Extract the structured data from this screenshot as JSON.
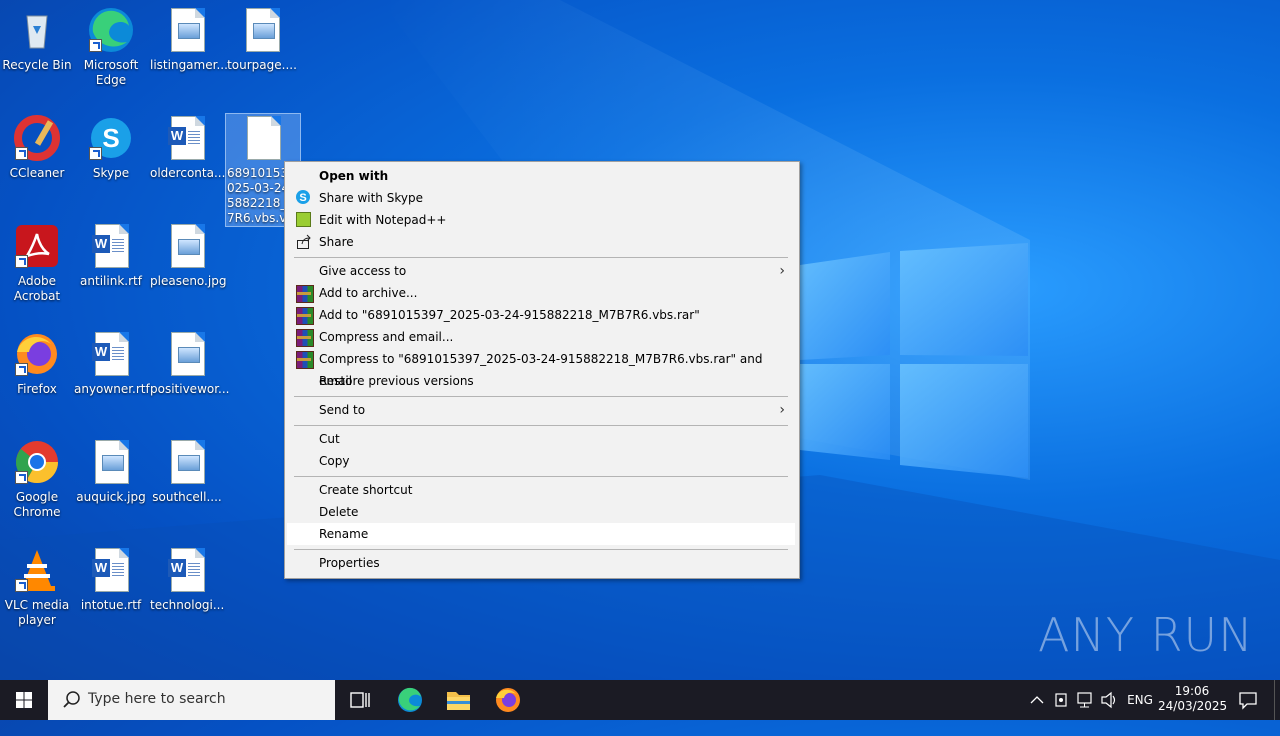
{
  "desktop": {
    "icons": [
      {
        "label": "Recycle Bin"
      },
      {
        "label": "Microsoft Edge"
      },
      {
        "label": "listingamer..."
      },
      {
        "label": "tourpage...."
      },
      {
        "label": "CCleaner"
      },
      {
        "label": "Skype"
      },
      {
        "label": "olderconta..."
      },
      {
        "label": "6891015397_2025-03-24-915882218_M7B7R6.vbs.vbs"
      },
      {
        "label": "Adobe Acrobat"
      },
      {
        "label": "antilink.rtf"
      },
      {
        "label": "pleaseno.jpg"
      },
      {
        "label": "Firefox"
      },
      {
        "label": "anyowner.rtf"
      },
      {
        "label": "positivewor..."
      },
      {
        "label": "Google Chrome"
      },
      {
        "label": "auquick.jpg"
      },
      {
        "label": "southcell...."
      },
      {
        "label": "VLC media player"
      },
      {
        "label": "intotue.rtf"
      },
      {
        "label": "technologi..."
      }
    ],
    "selected_label_lines": [
      "6891015397",
      "025-03-24-",
      "5882218_M",
      "7R6.vbs.vb"
    ]
  },
  "context_menu": {
    "items": [
      {
        "label": "Open with",
        "bold": true
      },
      {
        "label": "Share with Skype",
        "icon": "skype-icon"
      },
      {
        "label": "Edit with Notepad++",
        "icon": "notepadpp-icon"
      },
      {
        "label": "Share",
        "icon": "share-icon"
      },
      {
        "label": "Give access to",
        "submenu": true
      },
      {
        "label": "Add to archive...",
        "icon": "winrar-icon"
      },
      {
        "label": "Add to \"6891015397_2025-03-24-915882218_M7B7R6.vbs.rar\"",
        "icon": "winrar-icon"
      },
      {
        "label": "Compress and email...",
        "icon": "winrar-icon"
      },
      {
        "label": "Compress to \"6891015397_2025-03-24-915882218_M7B7R6.vbs.rar\" and email",
        "icon": "winrar-icon"
      },
      {
        "label": "Restore previous versions"
      },
      {
        "label": "Send to",
        "submenu": true
      },
      {
        "label": "Cut"
      },
      {
        "label": "Copy"
      },
      {
        "label": "Create shortcut"
      },
      {
        "label": "Delete"
      },
      {
        "label": "Rename",
        "highlighted": true
      },
      {
        "label": "Properties"
      }
    ],
    "arrow": "›"
  },
  "taskbar": {
    "search_placeholder": "Type here to search",
    "language": "ENG",
    "time": "19:06",
    "date": "24/03/2025"
  },
  "watermark": "ANY RUN"
}
